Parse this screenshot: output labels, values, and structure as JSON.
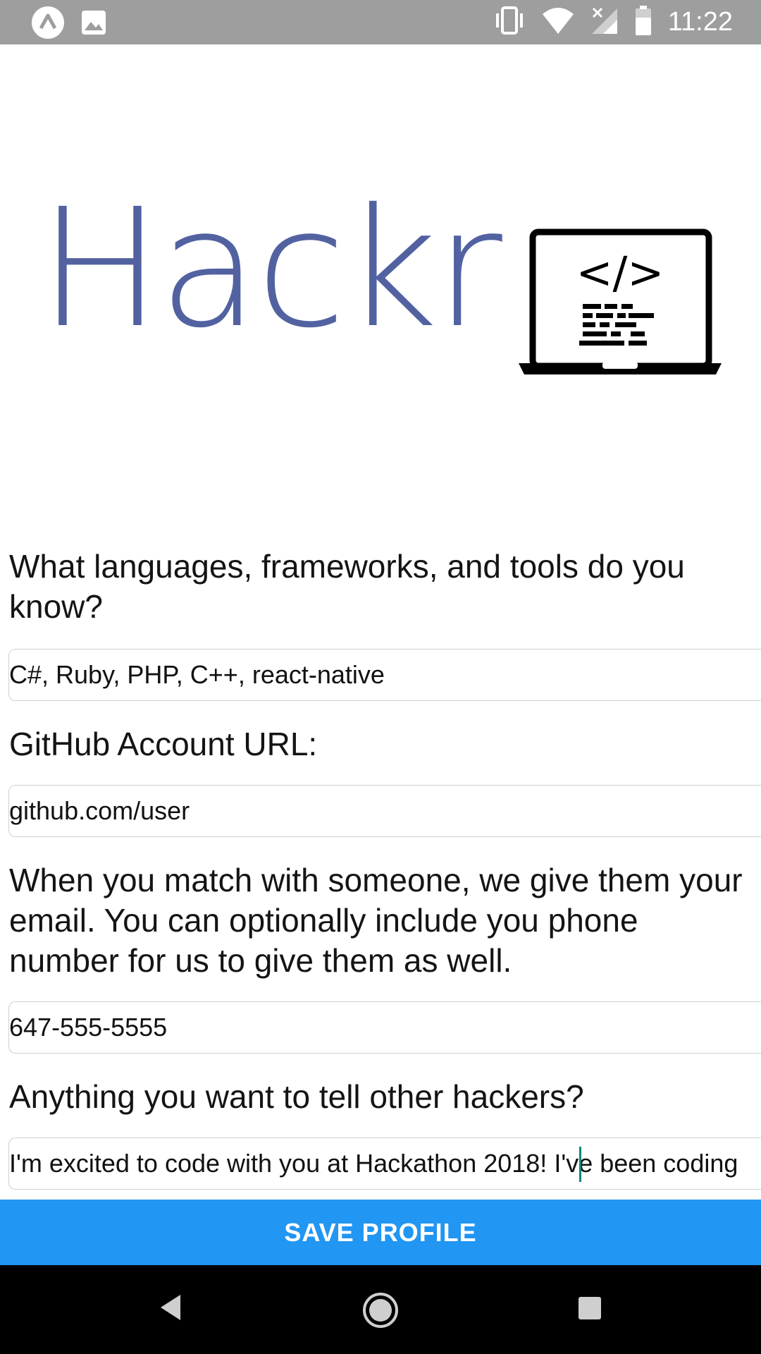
{
  "status_bar": {
    "time": "11:22",
    "left_icons": [
      "expo-icon",
      "image-icon"
    ],
    "right_icons": [
      "vibrate-icon",
      "wifi-icon",
      "signal-off-icon",
      "battery-icon"
    ]
  },
  "logo": {
    "text": "Hackr",
    "laptop_code": "</>",
    "color": "#5262a1"
  },
  "form": {
    "languages_label": "What languages, frameworks, and tools do you know?",
    "languages_value": "C#, Ruby, PHP, C++, react-native",
    "github_label": "GitHub Account URL:",
    "github_value": "github.com/user",
    "phone_label": "When you match with someone, we give them your email. You can optionally include you phone number for us to give them as well.",
    "phone_value": "647-555-5555",
    "about_label": "Anything you want to tell other hackers?",
    "about_value": "I'm excited to code with you at Hackathon 2018! I've been coding"
  },
  "save_button": {
    "label": "SAVE PROFILE",
    "color": "#2196f3"
  },
  "nav_bar": {
    "icons": [
      "back-icon",
      "home-icon",
      "recents-icon"
    ]
  }
}
